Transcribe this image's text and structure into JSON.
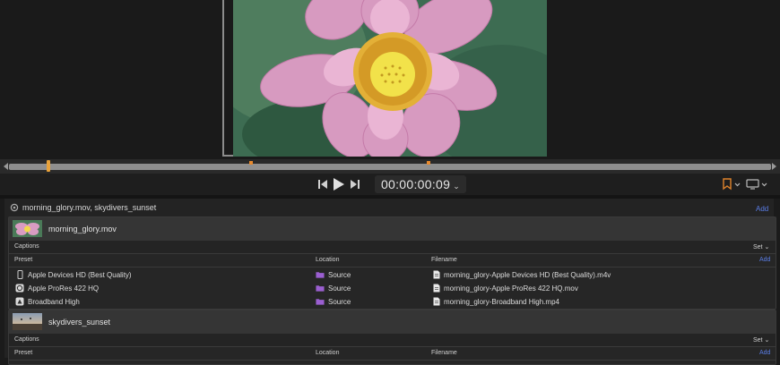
{
  "transport": {
    "timecode": "00:00:00:09"
  },
  "batch": {
    "title": "morning_glory.mov, skydivers_sunset",
    "add_label": "Add"
  },
  "jobs": [
    {
      "name": "morning_glory.mov",
      "captions_label": "Captions",
      "set_label": "Set",
      "columns": {
        "preset": "Preset",
        "location": "Location",
        "filename": "Filename"
      },
      "add_label": "Add",
      "outputs": [
        {
          "preset": "Apple Devices HD (Best Quality)",
          "preset_icon": "phone-icon",
          "location": "Source",
          "filename": "morning_glory-Apple Devices HD (Best Quality).m4v"
        },
        {
          "preset": "Apple ProRes 422 HQ",
          "preset_icon": "prores-icon",
          "location": "Source",
          "filename": "morning_glory-Apple ProRes 422 HQ.mov"
        },
        {
          "preset": "Broadband High",
          "preset_icon": "broadband-icon",
          "location": "Source",
          "filename": "morning_glory-Broadband High.mp4"
        }
      ]
    },
    {
      "name": "skydivers_sunset",
      "captions_label": "Captions",
      "set_label": "Set",
      "columns": {
        "preset": "Preset",
        "location": "Location",
        "filename": "Filename"
      },
      "add_label": "Add",
      "outputs": []
    }
  ],
  "colors": {
    "accent_blue": "#5a7de6",
    "playhead_orange": "#e9a23a",
    "folder_purple": "#9b5fd1"
  }
}
